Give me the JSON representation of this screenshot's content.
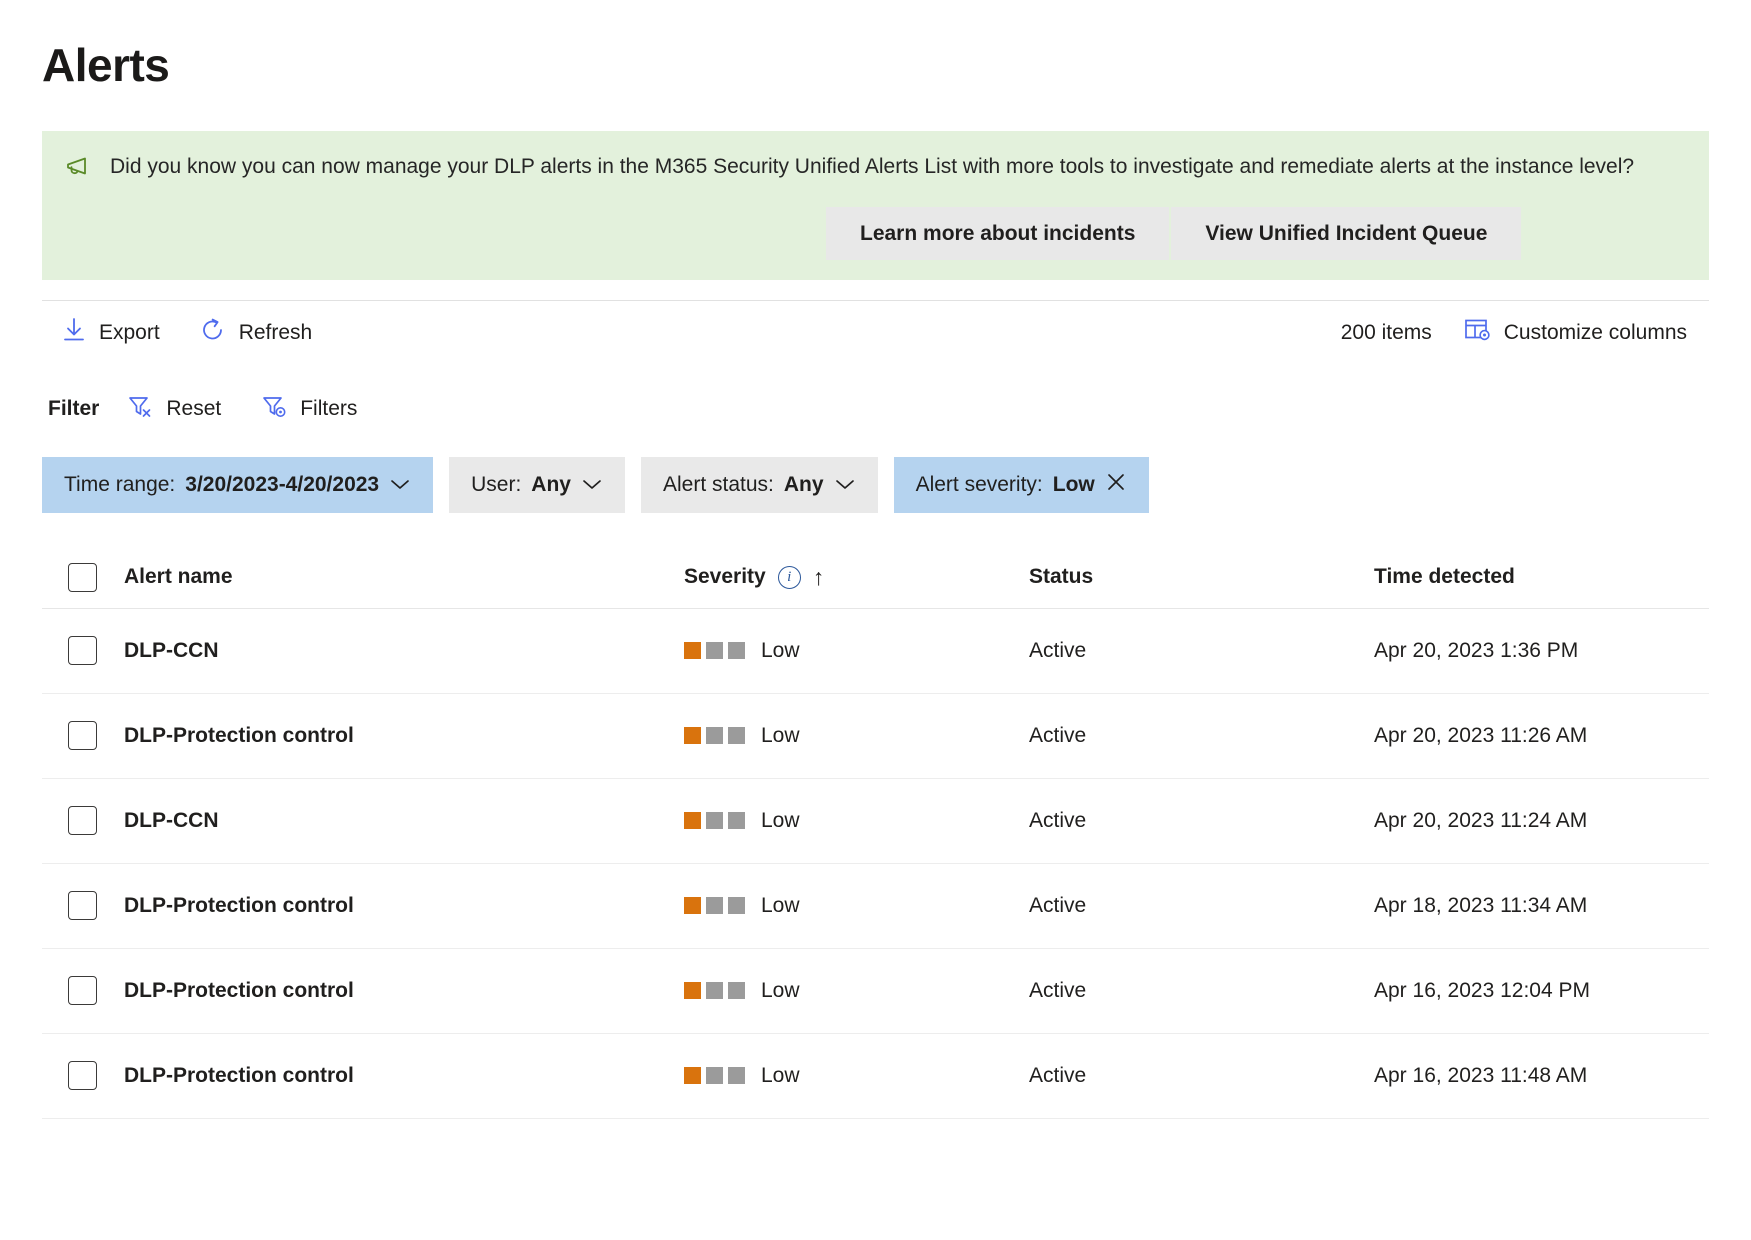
{
  "page": {
    "title": "Alerts"
  },
  "banner": {
    "icon": "megaphone-icon",
    "message": "Did you know you can now manage your DLP alerts in the M365 Security Unified Alerts List with more tools to investigate and remediate alerts at the instance level?",
    "learn_more_label": "Learn more about incidents",
    "view_queue_label": "View Unified Incident Queue",
    "background_color": "#e3f1dc",
    "icon_color": "#558b2f",
    "button_background": "#e8e8e8"
  },
  "commandbar": {
    "export_label": "Export",
    "export_icon": "download-arrow-icon",
    "refresh_label": "Refresh",
    "refresh_icon": "refresh-circle-icon",
    "items_count": "200 items",
    "customize_columns_label": "Customize columns",
    "customize_columns_icon": "table-gear-icon",
    "accent_color": "#4f6bed"
  },
  "filterbar": {
    "label": "Filter",
    "reset_label": "Reset",
    "reset_icon": "funnel-x-icon",
    "filters_label": "Filters",
    "filters_icon": "funnel-gear-icon"
  },
  "filters": [
    {
      "name": "time-range",
      "label": "Time range:",
      "value": "3/20/2023-4/20/2023",
      "trailing_icon": "chevron-down-icon",
      "selected": true
    },
    {
      "name": "user",
      "label": "User:",
      "value": "Any",
      "trailing_icon": "chevron-down-icon",
      "selected": false
    },
    {
      "name": "alert-status",
      "label": "Alert status:",
      "value": "Any",
      "trailing_icon": "chevron-down-icon",
      "selected": false
    },
    {
      "name": "alert-severity",
      "label": "Alert severity:",
      "value": "Low",
      "trailing_icon": "close-x-icon",
      "selected": true
    }
  ],
  "table": {
    "columns": {
      "name": "Alert name",
      "severity": "Severity",
      "status": "Status",
      "time": "Time detected"
    },
    "severity_info_icon": "info-icon",
    "sort_icon": "sort-ascending-arrow-icon",
    "severity_colors": {
      "active": "#d9730d",
      "inactive": "#9b9b9b"
    },
    "rows": [
      {
        "name": "DLP-CCN",
        "severity": "Low",
        "severity_level": 1,
        "status": "Active",
        "time": "Apr 20, 2023 1:36 PM"
      },
      {
        "name": "DLP-Protection control",
        "severity": "Low",
        "severity_level": 1,
        "status": "Active",
        "time": "Apr 20, 2023 11:26 AM"
      },
      {
        "name": "DLP-CCN",
        "severity": "Low",
        "severity_level": 1,
        "status": "Active",
        "time": "Apr 20, 2023 11:24 AM"
      },
      {
        "name": "DLP-Protection control",
        "severity": "Low",
        "severity_level": 1,
        "status": "Active",
        "time": "Apr 18, 2023 11:34 AM"
      },
      {
        "name": "DLP-Protection control",
        "severity": "Low",
        "severity_level": 1,
        "status": "Active",
        "time": "Apr 16, 2023 12:04 PM"
      },
      {
        "name": "DLP-Protection control",
        "severity": "Low",
        "severity_level": 1,
        "status": "Active",
        "time": "Apr 16, 2023 11:48 AM"
      }
    ]
  }
}
